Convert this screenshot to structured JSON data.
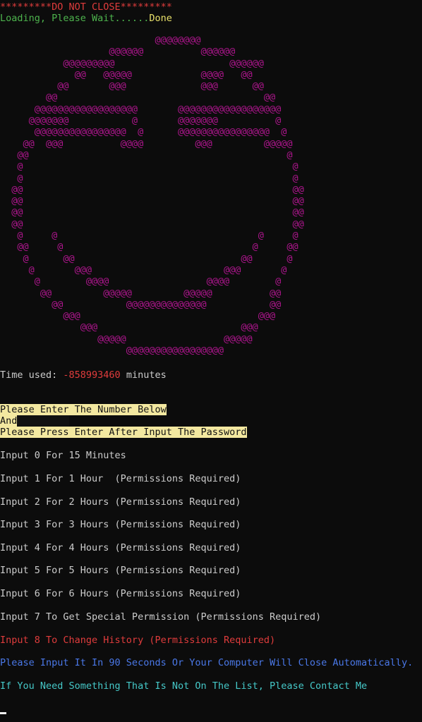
{
  "header": {
    "warning": "*********DO NOT CLOSE*********",
    "loading_prefix": "Loading, Please Wait......",
    "loading_status": "Done"
  },
  "ascii_art": [
    "                           @@@@@@@@",
    "                   @@@@@@          @@@@@@",
    "           @@@@@@@@@                    @@@@@@",
    "             @@   @@@@@            @@@@   @@",
    "          @@       @@@             @@@      @@",
    "        @@                                    @@",
    "      @@@@@@@@@@@@@@@@@@       @@@@@@@@@@@@@@@@@@",
    "     @@@@@@@           @       @@@@@@@          @",
    "      @@@@@@@@@@@@@@@@  @      @@@@@@@@@@@@@@@@  @",
    "    @@  @@@          @@@@         @@@         @@@@@",
    "   @@                                             @",
    "   @                                               @",
    "   @                                               @",
    "  @@                                               @@",
    "  @@                                               @@",
    "  @@                                               @@",
    "  @@                                               @@",
    "   @     @                                   @     @",
    "   @@     @                                 @     @@",
    "    @      @@                             @@      @",
    "     @       @@@                       @@@       @",
    "      @        @@@@                 @@@@        @",
    "       @@         @@@@@         @@@@@          @@",
    "         @@           @@@@@@@@@@@@@@           @@",
    "           @@@                               @@@",
    "              @@@                         @@@",
    "                 @@@@@                 @@@@@",
    "                      @@@@@@@@@@@@@@@@@"
  ],
  "time_used": {
    "label": "Time used: ",
    "value": "-858993460",
    "unit": " minutes"
  },
  "instructions": {
    "line1": "Please Enter The Number Below",
    "line2": "And",
    "line3": "Please Press Enter After Input The Password"
  },
  "menu": [
    "Input 0 For 15 Minutes",
    "Input 1 For 1 Hour  (Permissions Required)",
    "Input 2 For 2 Hours (Permissions Required)",
    "Input 3 For 3 Hours (Permissions Required)",
    "Input 4 For 4 Hours (Permissions Required)",
    "Input 5 For 5 Hours (Permissions Required)",
    "Input 6 For 6 Hours (Permissions Required)",
    "Input 7 To Get Special Permission (Permissions Required)"
  ],
  "menu_special": "Input 8 To Change History (Permissions Required)",
  "warning_timeout": "Please Input It In 90 Seconds Or Your Computer Will Close Automatically.",
  "contact": "If You Need Something That Is Not On The List, Please Contact Me",
  "colors": {
    "background": "#0c0c0c",
    "ascii": "#b0168f",
    "warning_red": "#e03c3c",
    "loading_green": "#4db34d",
    "done_yellow": "#e8e06a",
    "highlight": "#f3e8a0",
    "blue": "#4a78e8",
    "cyan": "#45c8c8"
  }
}
